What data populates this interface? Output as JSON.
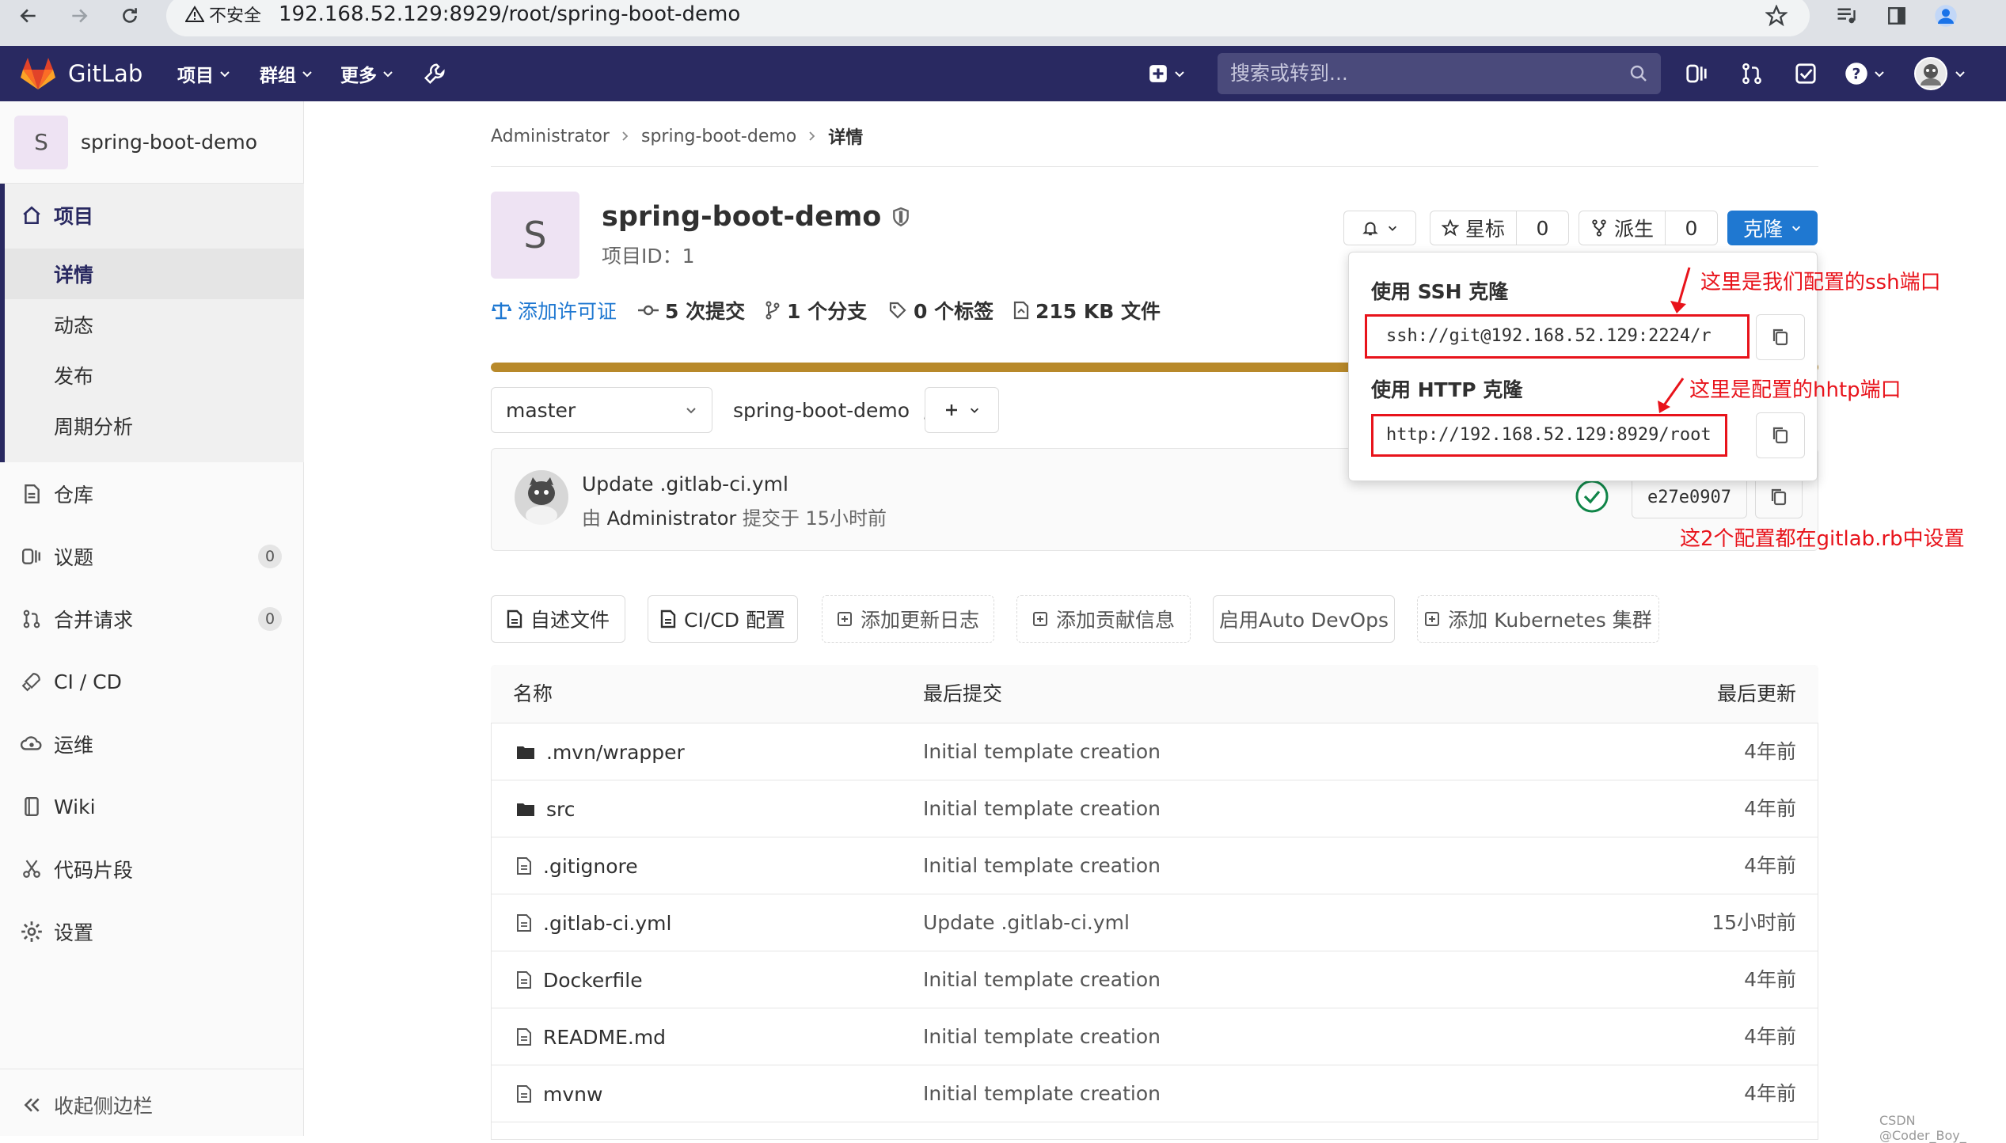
{
  "browser": {
    "insecure_label": "不安全",
    "url": "192.168.52.129:8929/root/spring-boot-demo"
  },
  "topnav": {
    "brand": "GitLab",
    "menu_projects": "项目",
    "menu_groups": "群组",
    "menu_more": "更多",
    "search_placeholder": "搜索或转到..."
  },
  "sidebar": {
    "project_avatar": "S",
    "project_name": "spring-boot-demo",
    "section_project": "项目",
    "sub_details": "详情",
    "sub_activity": "动态",
    "sub_releases": "发布",
    "sub_cycle": "周期分析",
    "repository": "仓库",
    "issues": "议题",
    "issues_count": "0",
    "merge_requests": "合并请求",
    "mr_count": "0",
    "cicd": "CI / CD",
    "operations": "运维",
    "wiki": "Wiki",
    "snippets": "代码片段",
    "settings": "设置",
    "collapse": "收起侧边栏"
  },
  "breadcrumb": {
    "owner": "Administrator",
    "project": "spring-boot-demo",
    "current": "详情"
  },
  "project": {
    "avatar": "S",
    "name": "spring-boot-demo",
    "id_label": "项目ID：1",
    "star_label": "星标",
    "star_count": "0",
    "fork_label": "派生",
    "fork_count": "0",
    "clone_label": "克隆",
    "add_license": "添加许可证",
    "commits": "5 次提交",
    "branches": "1 个分支",
    "tags": "0 个标签",
    "files_size": "215 KB 文件"
  },
  "repo": {
    "branch": "master",
    "path": "spring-boot-demo",
    "path_sep": "/",
    "commit_title": "Update .gitlab-ci.yml",
    "commit_by_prefix": "由 ",
    "commit_author": "Administrator",
    "commit_time": " 提交于 15小时前",
    "commit_sha": "e27e0907"
  },
  "clone_dropdown": {
    "ssh_title": "使用 SSH 克隆",
    "ssh_url": "ssh://git@192.168.52.129:2224/r",
    "http_title": "使用 HTTP 克隆",
    "http_url": "http://192.168.52.129:8929/root"
  },
  "annotations": {
    "ssh_note": "这里是我们配置的ssh端口",
    "http_note": "这里是配置的hhtp端口",
    "config_note": "这2个配置都在gitlab.rb中设置",
    "color": "#e8131b"
  },
  "quick_actions": [
    "自述文件",
    "CI/CD 配置",
    "添加更新日志",
    "添加贡献信息",
    "启用Auto DevOps",
    "添加 Kubernetes 集群"
  ],
  "file_table": {
    "col_name": "名称",
    "col_last_commit": "最后提交",
    "col_last_update": "最后更新",
    "rows": [
      {
        "name": ".mvn/wrapper",
        "type": "folder-icon",
        "commit": "Initial template creation",
        "updated": "4年前"
      },
      {
        "name": "src",
        "type": "folder-icon",
        "commit": "Initial template creation",
        "updated": "4年前"
      },
      {
        "name": ".gitignore",
        "type": "file-icon",
        "commit": "Initial template creation",
        "updated": "4年前"
      },
      {
        "name": ".gitlab-ci.yml",
        "type": "file-icon",
        "commit": "Update .gitlab-ci.yml",
        "updated": "15小时前"
      },
      {
        "name": "Dockerfile",
        "type": "file-icon",
        "commit": "Initial template creation",
        "updated": "4年前"
      },
      {
        "name": "README.md",
        "type": "file-icon",
        "commit": "Initial template creation",
        "updated": "4年前"
      },
      {
        "name": "mvnw",
        "type": "file-icon",
        "commit": "Initial template creation",
        "updated": "4年前"
      }
    ]
  },
  "watermark": "CSDN @Coder_Boy_",
  "colors": {
    "nav_bg": "#292961",
    "accent_blue": "#1f78d1",
    "progress_bar": "#b8892a",
    "pipeline_green": "#108548"
  }
}
